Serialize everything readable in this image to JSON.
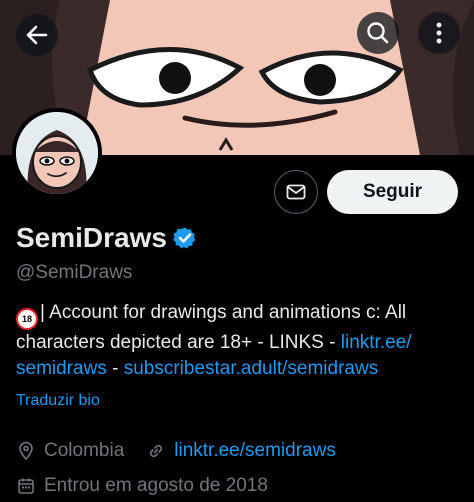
{
  "profile": {
    "display_name": "SemiDraws",
    "handle": "@SemiDraws",
    "follow_label": "Seguir",
    "verified_icon": "verified-badge-icon"
  },
  "bio": {
    "badge_text": "18",
    "text": "| Account for drawings and animations c: All characters depicted are 18+  - LINKS - ",
    "link1": "linktr.ee/ semidraws",
    "separator": " - ",
    "link2": "subscribestar.adult/semidraws",
    "translate_label": "Traduzir bio"
  },
  "meta": {
    "location": "Colombia",
    "website": "linktr.ee/semidraws",
    "joined": "Entrou em agosto de 2018"
  },
  "colors": {
    "background": "#000000",
    "link": "#1d9bf0",
    "secondary_text": "#71767b",
    "follow_button_bg": "#eff3f4"
  }
}
